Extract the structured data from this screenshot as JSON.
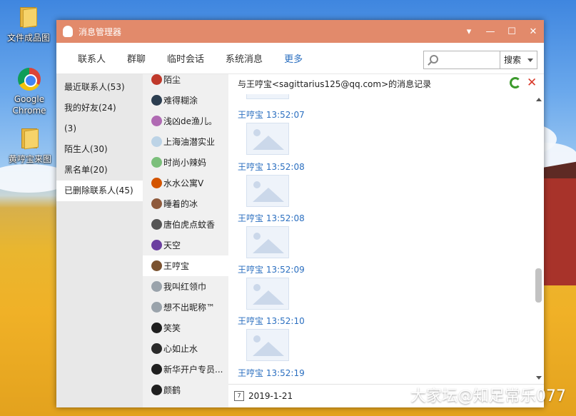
{
  "desktop": {
    "icons": [
      {
        "label": "文件成品图",
        "icon": "folder-icon"
      },
      {
        "label": "Google Chrome",
        "icon": "chrome-icon"
      },
      {
        "label": "黄哼宝来图",
        "icon": "folder-icon"
      }
    ],
    "watermark": "大家坛@知足常乐077"
  },
  "window": {
    "title": "消息管理器",
    "controls": {
      "dropdown": "▾",
      "minimize": "—",
      "maximize": "☐",
      "close": "✕"
    },
    "tabs": [
      "联系人",
      "群聊",
      "临时会话",
      "系统消息",
      "更多"
    ],
    "active_tab": "更多",
    "search": {
      "button_label": "搜索",
      "placeholder": ""
    },
    "accent_color": "#e28a6b"
  },
  "groups": {
    "items": [
      "最近联系人(53)",
      "我的好友(24)",
      "(3)",
      "陌生人(30)",
      "黑名单(20)",
      "已删除联系人(45)"
    ],
    "selected": "已删除联系人(45)"
  },
  "contacts": {
    "items": [
      "陌尘",
      "难得糊涂",
      "浅凶de渔儿。",
      "上海油潜实业",
      "时尚小辣妈",
      "水水公寓V",
      "睡着的冰",
      "唐伯虎点蚊香",
      "天空",
      "王哼宝",
      "我叫红领巾",
      "想不出昵称™",
      "笑笑",
      "心如止水",
      "新华开户专员...",
      "颜鹤"
    ],
    "selected": "王哼宝"
  },
  "conversation": {
    "header": "与王哼宝<sagittarius125@qq.com>的消息记录",
    "messages": [
      {
        "sender": "王哼宝",
        "time": "13:52:07"
      },
      {
        "sender": "王哼宝",
        "time": "13:52:08"
      },
      {
        "sender": "王哼宝",
        "time": "13:52:08"
      },
      {
        "sender": "王哼宝",
        "time": "13:52:09"
      },
      {
        "sender": "王哼宝",
        "time": "13:52:10"
      },
      {
        "sender": "王哼宝",
        "time": "13:52:19"
      }
    ],
    "date": "2019-1-21",
    "calendar_day": "7"
  }
}
